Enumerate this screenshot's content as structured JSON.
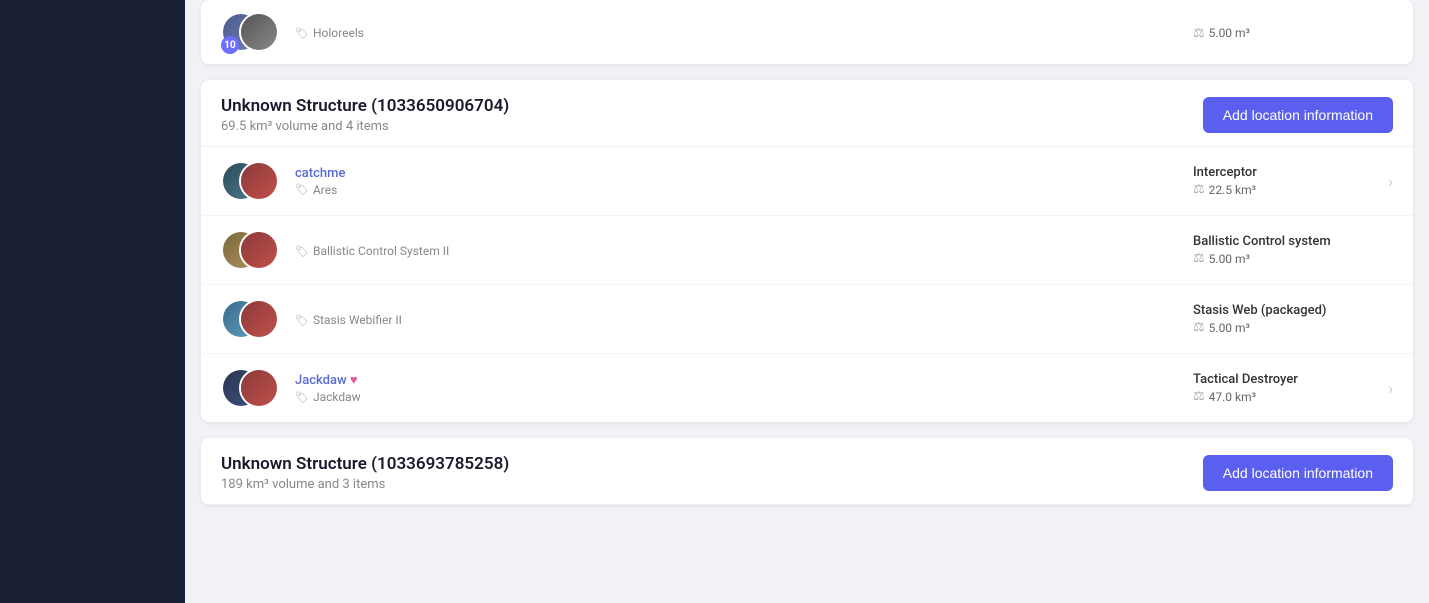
{
  "sidebar": {
    "background": "#1a2035"
  },
  "top_item": {
    "badge": "10",
    "name": "Holoreels",
    "type": "",
    "volume": "5.00 m³"
  },
  "structures": [
    {
      "id": "structure-1",
      "title": "Unknown Structure (1033650906704)",
      "subtitle": "69.5 km³ volume and 4 items",
      "add_btn_label": "Add location information",
      "items": [
        {
          "id": "catchme",
          "name_link": "catchme",
          "tag": "Ares",
          "type": "Interceptor",
          "volume": "22.5 km³",
          "has_arrow": true,
          "avatar_left_class": "av-catchme-ship",
          "avatar_right_class": "av-catchme-char"
        },
        {
          "id": "bcs",
          "name_link": null,
          "name": "Ballistic Control System II",
          "tag": null,
          "type": "Ballistic Control system",
          "volume": "5.00 m³",
          "has_arrow": false,
          "avatar_left_class": "av-bcs-item",
          "avatar_right_class": "av-bcs-char"
        },
        {
          "id": "stasis",
          "name_link": null,
          "name": "Stasis Webifier II",
          "tag": null,
          "type": "Stasis Web (packaged)",
          "volume": "5.00 m³",
          "has_arrow": false,
          "avatar_left_class": "av-stasis-item",
          "avatar_right_class": "av-stasis-char"
        },
        {
          "id": "jackdaw",
          "name_link": "Jackdaw",
          "name_heart": "♥",
          "tag": "Jackdaw",
          "type": "Tactical Destroyer",
          "volume": "47.0 km³",
          "has_arrow": true,
          "avatar_left_class": "av-jackdaw-ship",
          "avatar_right_class": "av-jackdaw-char"
        }
      ]
    },
    {
      "id": "structure-2",
      "title": "Unknown Structure (1033693785258)",
      "subtitle": "189 km³ volume and 3 items",
      "add_btn_label": "Add location information",
      "items": []
    }
  ]
}
